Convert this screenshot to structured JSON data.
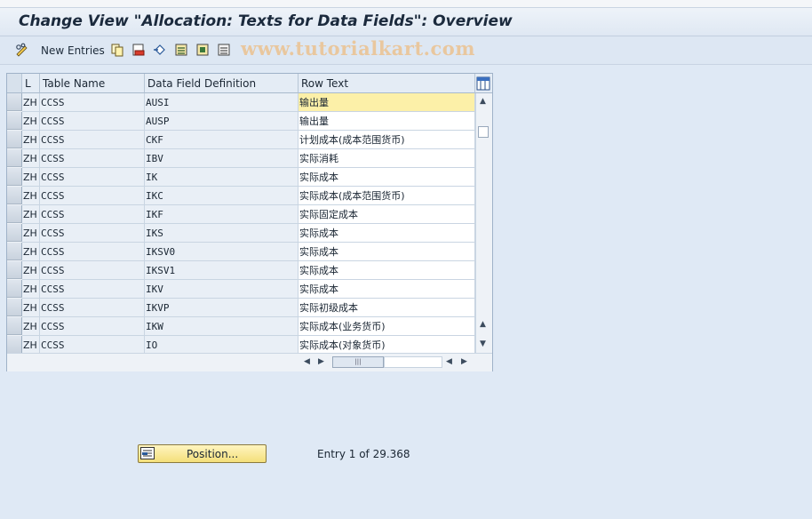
{
  "window": {
    "title": "Change View \"Allocation: Texts for Data Fields\": Overview"
  },
  "toolbar": {
    "new_entries_label": "New Entries",
    "watermark": "www.tutorialkart.com",
    "icons": [
      "pencil-glasses-icon",
      "copy-icon",
      "delete-icon",
      "undo-icon",
      "select-all-icon",
      "select-block-icon",
      "deselect-all-icon"
    ]
  },
  "table": {
    "columns": [
      "L",
      "Table Name",
      "Data Field Definition",
      "Row Text"
    ],
    "rows": [
      [
        "ZH",
        "CCSS",
        "AUSI",
        "输出量"
      ],
      [
        "ZH",
        "CCSS",
        "AUSP",
        "输出量"
      ],
      [
        "ZH",
        "CCSS",
        "CKF",
        "计划成本(成本范围货币)"
      ],
      [
        "ZH",
        "CCSS",
        "IBV",
        "实际消耗"
      ],
      [
        "ZH",
        "CCSS",
        "IK",
        "实际成本"
      ],
      [
        "ZH",
        "CCSS",
        "IKC",
        "实际成本(成本范围货币)"
      ],
      [
        "ZH",
        "CCSS",
        "IKF",
        "实际固定成本"
      ],
      [
        "ZH",
        "CCSS",
        "IKS",
        "实际成本"
      ],
      [
        "ZH",
        "CCSS",
        "IKSV0",
        "实际成本"
      ],
      [
        "ZH",
        "CCSS",
        "IKSV1",
        "实际成本"
      ],
      [
        "ZH",
        "CCSS",
        "IKV",
        "实际成本"
      ],
      [
        "ZH",
        "CCSS",
        "IKVP",
        "实际初级成本"
      ],
      [
        "ZH",
        "CCSS",
        "IKW",
        "实际成本(业务货币)"
      ],
      [
        "ZH",
        "CCSS",
        "IO",
        "实际成本(对象货币)"
      ]
    ],
    "highlight_color": "#fcf0a8"
  },
  "footer": {
    "position_button_label": "Position...",
    "entry_info": "Entry 1 of 29.368"
  }
}
